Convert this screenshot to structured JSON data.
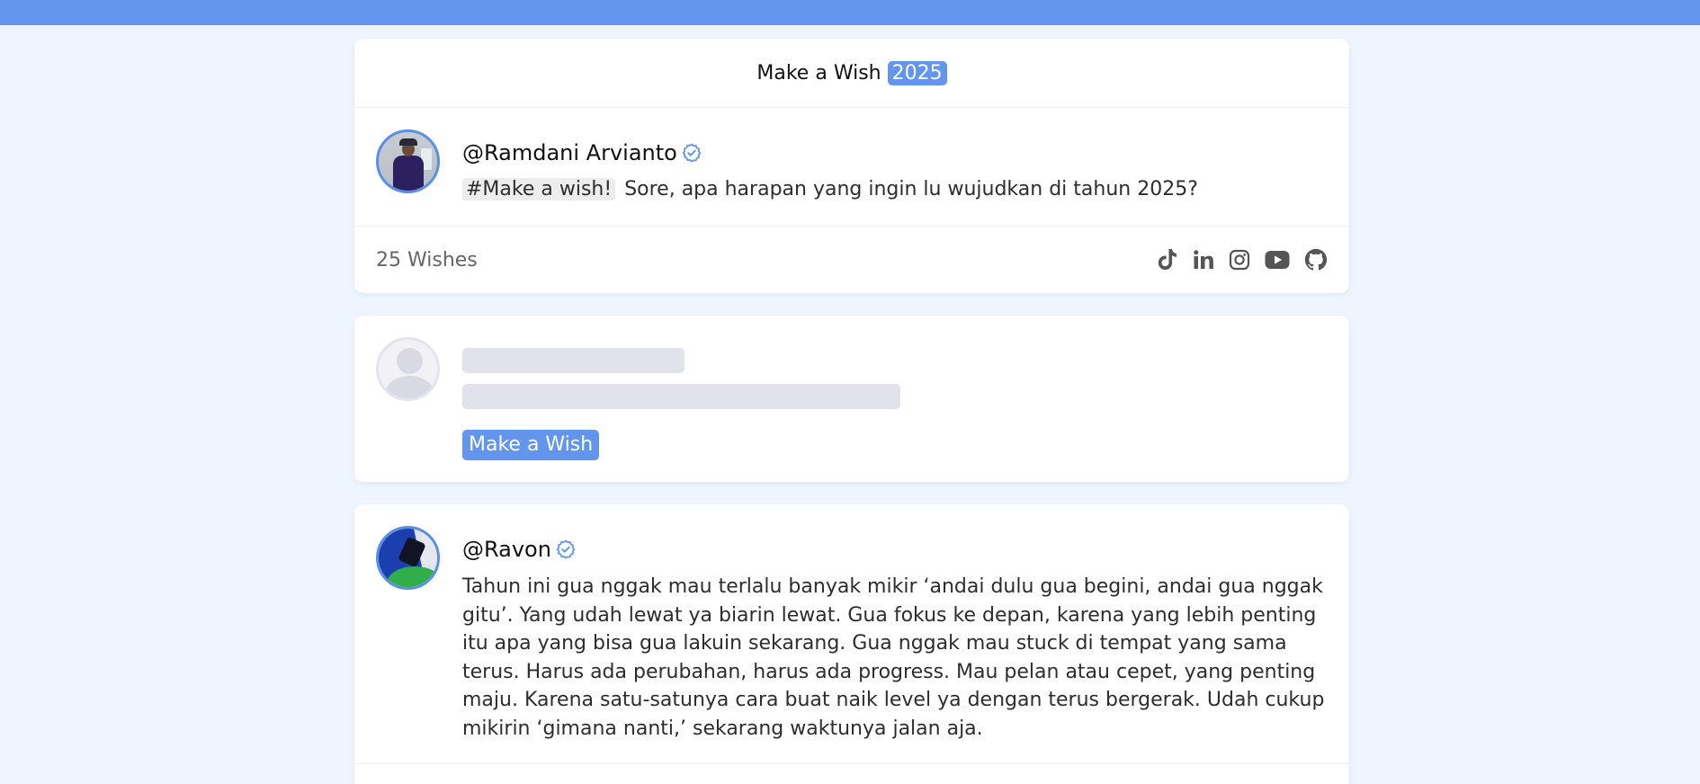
{
  "header": {
    "title": "Make a Wish",
    "year": "2025"
  },
  "main_post": {
    "username": "@Ramdani Arvianto",
    "hashtag": "#Make a wish!",
    "text": "Sore, apa harapan yang ingin lu wujudkan di tahun 2025?"
  },
  "stats": {
    "wishes": "25 Wishes",
    "socials": [
      "tiktok-icon",
      "linkedin-icon",
      "instagram-icon",
      "youtube-icon",
      "github-icon"
    ]
  },
  "compose": {
    "button_label": "Make a Wish"
  },
  "wishes": [
    {
      "username": "@Ravon",
      "text": "Tahun ini gua nggak mau terlalu banyak mikir ‘andai dulu gua begini, andai gua nggak gitu’. Yang udah lewat ya biarin lewat. Gua fokus ke depan, karena yang lebih penting itu apa yang bisa gua lakuin sekarang. Gua nggak mau stuck di tempat yang sama terus. Harus ada perubahan, harus ada progress. Mau pelan atau cepet, yang penting maju. Karena satu-satunya cara buat naik level ya dengan terus bergerak. Udah cukup mikirin ‘gimana nanti,’ sekarang waktunya jalan aja."
    }
  ],
  "colors": {
    "accent": "#6495ed",
    "page_bg": "#eef5ff",
    "verified": "#6495ed"
  }
}
